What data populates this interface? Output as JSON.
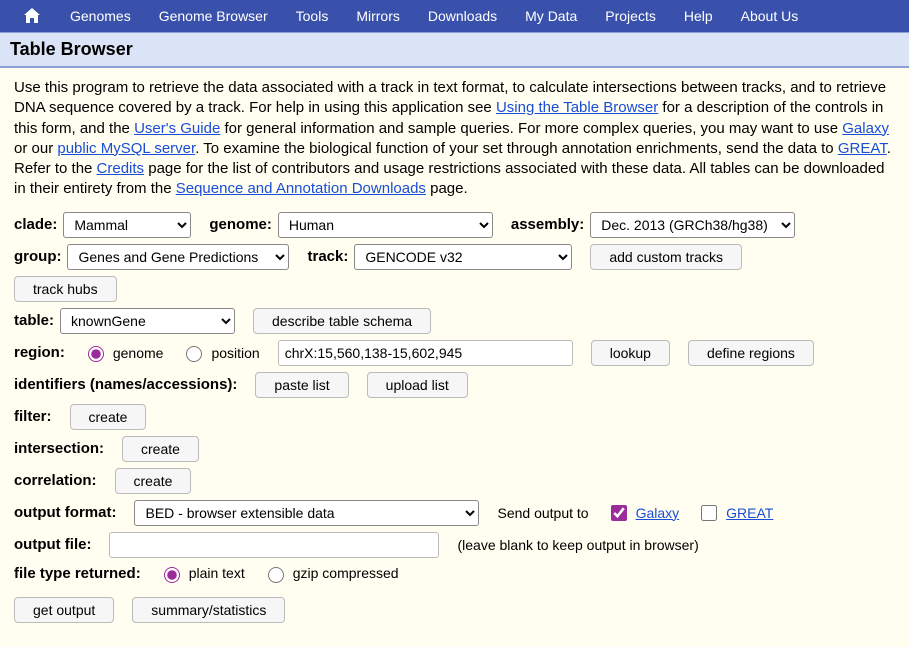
{
  "nav": {
    "items": [
      "Genomes",
      "Genome Browser",
      "Tools",
      "Mirrors",
      "Downloads",
      "My Data",
      "Projects",
      "Help",
      "About Us"
    ]
  },
  "title": "Table Browser",
  "intro": {
    "t1": "Use this program to retrieve the data associated with a track in text format, to calculate intersections between tracks, and to retrieve DNA sequence covered by a track. For help in using this application see ",
    "link_table_browser": "Using the Table Browser",
    "t2": " for a description of the controls in this form, and the ",
    "link_users_guide": "User's Guide",
    "t3": " for general information and sample queries. For more complex queries, you may want to use ",
    "link_galaxy": "Galaxy",
    "t4": " or our ",
    "link_mysql": "public MySQL server",
    "t5": ". To examine the biological function of your set through annotation enrichments, send the data to ",
    "link_great": "GREAT",
    "t6": ". Refer to the ",
    "link_credits": "Credits",
    "t7": " page for the list of contributors and usage restrictions associated with these data. All tables can be downloaded in their entirety from the ",
    "link_seq_downloads": "Sequence and Annotation Downloads",
    "t8": " page."
  },
  "labels": {
    "clade": "clade:",
    "genome": "genome:",
    "assembly": "assembly:",
    "group": "group:",
    "track": "track:",
    "table": "table:",
    "region": "region:",
    "identifiers": "identifiers (names/accessions):",
    "filter": "filter:",
    "intersection": "intersection:",
    "correlation": "correlation:",
    "output_format": "output format:",
    "output_file": "output file:",
    "file_type": "file type returned:"
  },
  "selects": {
    "clade": "Mammal",
    "genome": "Human",
    "assembly": "Dec. 2013 (GRCh38/hg38)",
    "group": "Genes and Gene Predictions",
    "track": "GENCODE v32",
    "table": "knownGene",
    "output_format": "BED - browser extensible data"
  },
  "buttons": {
    "add_custom_tracks": "add custom tracks",
    "track_hubs": "track hubs",
    "describe_schema": "describe table schema",
    "lookup": "lookup",
    "define_regions": "define regions",
    "paste_list": "paste list",
    "upload_list": "upload list",
    "create": "create",
    "get_output": "get output",
    "summary": "summary/statistics"
  },
  "region": {
    "opt_genome": "genome",
    "opt_position": "position",
    "position_value": "chrX:15,560,138-15,602,945"
  },
  "send_output": {
    "label": "Send output to",
    "galaxy": "Galaxy",
    "great": "GREAT"
  },
  "output_file_note": "(leave blank to keep output in browser)",
  "file_type": {
    "plain": "plain text",
    "gzip": "gzip compressed"
  }
}
